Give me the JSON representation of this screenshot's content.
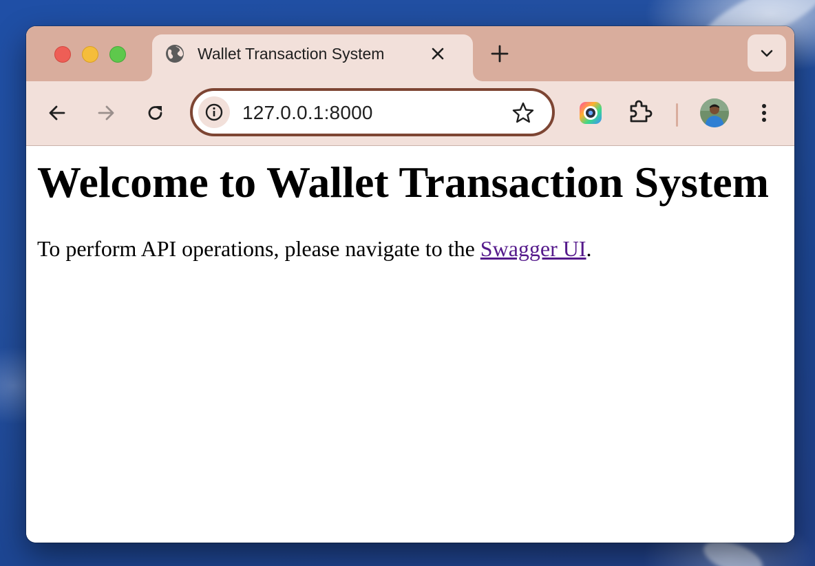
{
  "browser": {
    "tab": {
      "title": "Wallet Transaction System",
      "favicon": "globe-icon"
    },
    "address_bar": {
      "url": "127.0.0.1:8000"
    },
    "colors": {
      "frame": "#d9ad9d",
      "toolbar": "#f2e0da",
      "omnibox_border": "#7d4533"
    }
  },
  "page": {
    "heading": "Welcome to Wallet Transaction System",
    "paragraph_prefix": "To perform API operations, please navigate to the ",
    "link_text": "Swagger UI",
    "paragraph_suffix": ".",
    "link_color": "#551a8b"
  }
}
